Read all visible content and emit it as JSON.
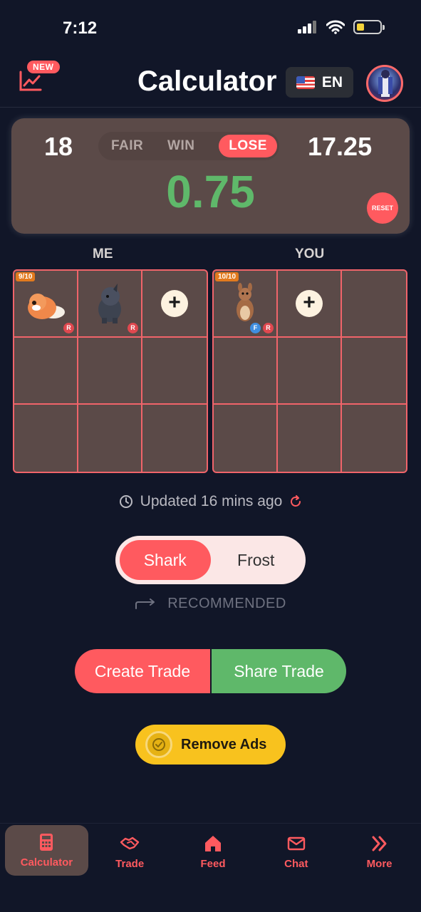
{
  "status_bar": {
    "time": "7:12"
  },
  "header": {
    "new_badge": "NEW",
    "title": "Calculator",
    "language": "EN"
  },
  "summary": {
    "left_value": "18",
    "right_value": "17.25",
    "modes": [
      "FAIR",
      "WIN",
      "LOSE"
    ],
    "active_mode": "LOSE",
    "difference": "0.75",
    "reset_label": "RESET"
  },
  "grids": {
    "me": {
      "label": "ME",
      "count": "9/10"
    },
    "you": {
      "label": "YOU",
      "count": "10/10"
    }
  },
  "badges": {
    "rideable": "R",
    "fly": "F"
  },
  "updated": {
    "text": "Updated 16 mins ago"
  },
  "toggle": {
    "option_1": "Shark",
    "option_2": "Frost",
    "recommended": "RECOMMENDED"
  },
  "actions": {
    "create": "Create Trade",
    "share": "Share Trade",
    "remove_ads": "Remove Ads"
  },
  "nav": [
    {
      "label": "Calculator",
      "icon": "calculator-icon"
    },
    {
      "label": "Trade",
      "icon": "handshake-icon"
    },
    {
      "label": "Feed",
      "icon": "home-icon"
    },
    {
      "label": "Chat",
      "icon": "mail-icon"
    },
    {
      "label": "More",
      "icon": "chevrons-right-icon"
    }
  ],
  "colors": {
    "accent": "#ff5a5f",
    "positive": "#5fb86a",
    "card": "#5b4a48",
    "background": "#111628",
    "ads": "#f8c21e"
  },
  "battery_level": 0.3
}
